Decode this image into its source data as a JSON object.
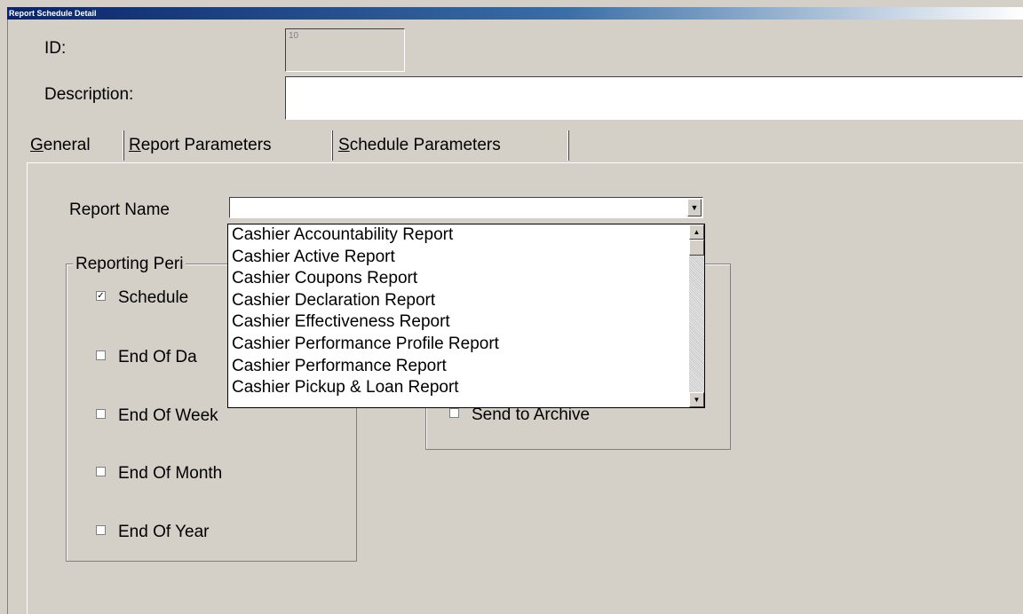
{
  "window": {
    "title": "Report Schedule Detail"
  },
  "form": {
    "id_label": "ID:",
    "id_value": "10",
    "description_label": "Description:",
    "description_value": ""
  },
  "tabs": [
    {
      "hotkey": "G",
      "rest": "eneral"
    },
    {
      "hotkey": "R",
      "rest": "eport Parameters"
    },
    {
      "hotkey": "S",
      "rest": "chedule Parameters"
    }
  ],
  "general": {
    "report_name_label": "Report Name",
    "report_name_value": "",
    "dropdown_items": [
      "Cashier Accountability Report",
      "Cashier Active Report",
      "Cashier Coupons Report",
      "Cashier Declaration Report",
      "Cashier Effectiveness Report",
      "Cashier Performance Profile Report",
      "Cashier Performance Report",
      "Cashier Pickup & Loan Report"
    ],
    "reporting_period": {
      "title": "Reporting Peri",
      "options": [
        {
          "label": "Schedule",
          "checked": true
        },
        {
          "label": "End Of Da",
          "checked": false
        },
        {
          "label": "End Of Week",
          "checked": false
        },
        {
          "label": "End Of Month",
          "checked": false
        },
        {
          "label": "End Of Year",
          "checked": false
        }
      ]
    },
    "output": {
      "send_to_archive_label": "Send to Archive",
      "send_to_archive_checked": false
    }
  },
  "icons": {
    "checkbox_checked": "checkmark-icon",
    "dropdown_arrow": "chevron-down-icon",
    "scroll_up": "scroll-up-arrow-icon",
    "scroll_down": "scroll-down-arrow-icon"
  }
}
